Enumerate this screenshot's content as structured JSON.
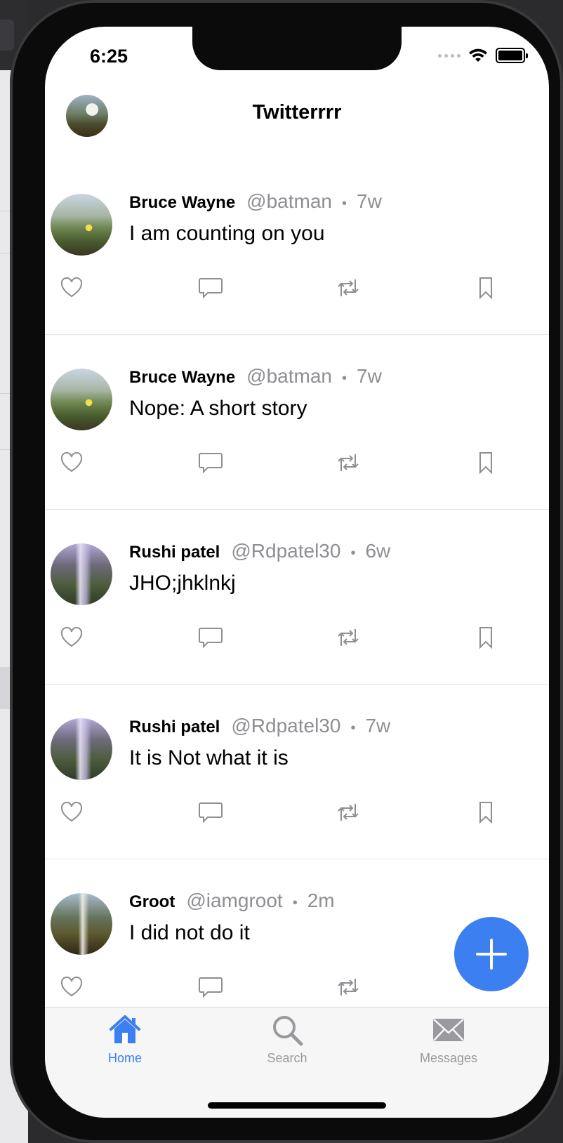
{
  "status": {
    "time": "6:25"
  },
  "nav": {
    "title": "Twitterrrr"
  },
  "tweets": [
    {
      "name": "Bruce Wayne",
      "handle": "@batman",
      "time": "7w",
      "text": "I am counting on you"
    },
    {
      "name": "Bruce Wayne",
      "handle": "@batman",
      "time": "7w",
      "text": "Nope: A short story"
    },
    {
      "name": "Rushi patel",
      "handle": "@Rdpatel30",
      "time": "6w",
      "text": "JHO;jhklnkj"
    },
    {
      "name": "Rushi patel",
      "handle": "@Rdpatel30",
      "time": "7w",
      "text": "It is Not what it is"
    },
    {
      "name": "Groot",
      "handle": "@iamgroot",
      "time": "2m",
      "text": "I did not do it"
    }
  ],
  "separator": "•",
  "tabs": [
    {
      "label": "Home",
      "icon": "house-icon",
      "active": true
    },
    {
      "label": "Search",
      "icon": "magnifier-icon",
      "active": false
    },
    {
      "label": "Messages",
      "icon": "envelope-icon",
      "active": false
    }
  ],
  "colors": {
    "accent": "#3b7ff0",
    "muted": "#8e8e93",
    "inactive_tab": "#9a9a9e"
  }
}
